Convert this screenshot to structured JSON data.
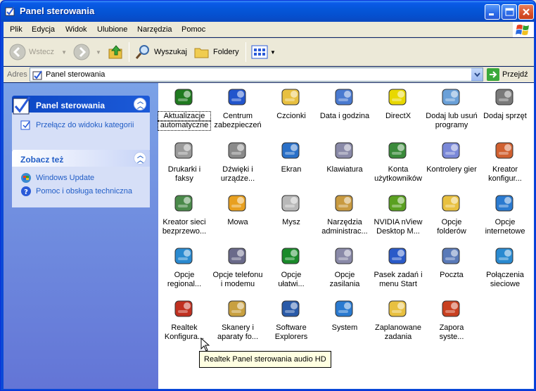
{
  "window": {
    "title": "Panel sterowania"
  },
  "menu": [
    "Plik",
    "Edycja",
    "Widok",
    "Ulubione",
    "Narzędzia",
    "Pomoc"
  ],
  "toolbar": {
    "back": "Wstecz",
    "search": "Wyszukaj",
    "folders": "Foldery"
  },
  "address": {
    "label": "Adres",
    "value": "Panel sterowania",
    "go": "Przejdź"
  },
  "sidebar": {
    "panel_title": "Panel sterowania",
    "switch_view": "Przełącz do widoku kategorii",
    "see_also_title": "Zobacz też",
    "links": [
      "Windows Update",
      "Pomoc i obsługa techniczna"
    ]
  },
  "items": [
    {
      "l1": "Aktualizacje",
      "l2": "automatyczne",
      "icon": "windows-update-icon",
      "color": "#1f7a1f"
    },
    {
      "l1": "Centrum",
      "l2": "zabezpieczeń",
      "icon": "security-shield-icon",
      "color": "#2255cc"
    },
    {
      "l1": "Czcionki",
      "l2": "",
      "icon": "fonts-folder-icon",
      "color": "#e8c040"
    },
    {
      "l1": "Data i godzina",
      "l2": "",
      "icon": "clock-icon",
      "color": "#4a7ad0"
    },
    {
      "l1": "DirectX",
      "l2": "",
      "icon": "directx-icon",
      "color": "#e8d800"
    },
    {
      "l1": "Dodaj lub usuń",
      "l2": "programy",
      "icon": "add-remove-icon",
      "color": "#6aa0d8"
    },
    {
      "l1": "Dodaj sprzęt",
      "l2": "",
      "icon": "add-hardware-icon",
      "color": "#7a7a7a"
    },
    {
      "l1": "Drukarki i",
      "l2": "faksy",
      "icon": "printer-icon",
      "color": "#9a9a9a"
    },
    {
      "l1": "Dźwięki i",
      "l2": "urządze...",
      "icon": "speaker-icon",
      "color": "#8a8a8a"
    },
    {
      "l1": "Ekran",
      "l2": "",
      "icon": "display-icon",
      "color": "#2a70c8"
    },
    {
      "l1": "Klawiatura",
      "l2": "",
      "icon": "keyboard-icon",
      "color": "#8a8aa8"
    },
    {
      "l1": "Konta",
      "l2": "użytkowników",
      "icon": "user-accounts-icon",
      "color": "#3a8a3a"
    },
    {
      "l1": "Kontrolery gier",
      "l2": "",
      "icon": "gamepad-icon",
      "color": "#7a88d8"
    },
    {
      "l1": "Kreator",
      "l2": "konfigur...",
      "icon": "network-wizard-icon",
      "color": "#d06030"
    },
    {
      "l1": "Kreator sieci",
      "l2": "bezprzewo...",
      "icon": "wireless-icon",
      "color": "#4a8a4a"
    },
    {
      "l1": "Mowa",
      "l2": "",
      "icon": "speech-icon",
      "color": "#e8a020"
    },
    {
      "l1": "Mysz",
      "l2": "",
      "icon": "mouse-icon",
      "color": "#b8b8b8"
    },
    {
      "l1": "Narzędzia",
      "l2": "administrac...",
      "icon": "admin-tools-icon",
      "color": "#c89a40"
    },
    {
      "l1": "NVIDIA nView",
      "l2": "Desktop M...",
      "icon": "nvidia-icon",
      "color": "#5aa020"
    },
    {
      "l1": "Opcje",
      "l2": "folderów",
      "icon": "folder-options-icon",
      "color": "#e8c040"
    },
    {
      "l1": "Opcje",
      "l2": "internetowe",
      "icon": "internet-options-icon",
      "color": "#2a7ad0"
    },
    {
      "l1": "Opcje",
      "l2": "regional...",
      "icon": "globe-icon",
      "color": "#2a8ad0"
    },
    {
      "l1": "Opcje telefonu",
      "l2": "i modemu",
      "icon": "phone-icon",
      "color": "#6a6a8a"
    },
    {
      "l1": "Opcje",
      "l2": "ułatwi...",
      "icon": "accessibility-icon",
      "color": "#1a8a2a"
    },
    {
      "l1": "Opcje zasilania",
      "l2": "",
      "icon": "power-icon",
      "color": "#8a8aa8"
    },
    {
      "l1": "Pasek zadań i",
      "l2": "menu Start",
      "icon": "taskbar-icon",
      "color": "#2a5ac8"
    },
    {
      "l1": "Poczta",
      "l2": "",
      "icon": "mail-icon",
      "color": "#5a7ab8"
    },
    {
      "l1": "Połączenia",
      "l2": "sieciowe",
      "icon": "network-connections-icon",
      "color": "#2a8ad0"
    },
    {
      "l1": "Realtek",
      "l2": "Konfigura...",
      "icon": "realtek-speaker-icon",
      "color": "#c03020"
    },
    {
      "l1": "Skanery i",
      "l2": "aparaty fo...",
      "icon": "scanner-icon",
      "color": "#c8a040"
    },
    {
      "l1": "Software",
      "l2": "Explorers",
      "icon": "software-explorers-icon",
      "color": "#2a5aa8"
    },
    {
      "l1": "System",
      "l2": "",
      "icon": "system-icon",
      "color": "#2a7ad0"
    },
    {
      "l1": "Zaplanowane",
      "l2": "zadania",
      "icon": "scheduled-tasks-icon",
      "color": "#e8c040"
    },
    {
      "l1": "Zapora",
      "l2": "syste...",
      "icon": "firewall-icon",
      "color": "#c84020"
    }
  ],
  "tooltip": "Realtek Panel sterowania audio HD"
}
